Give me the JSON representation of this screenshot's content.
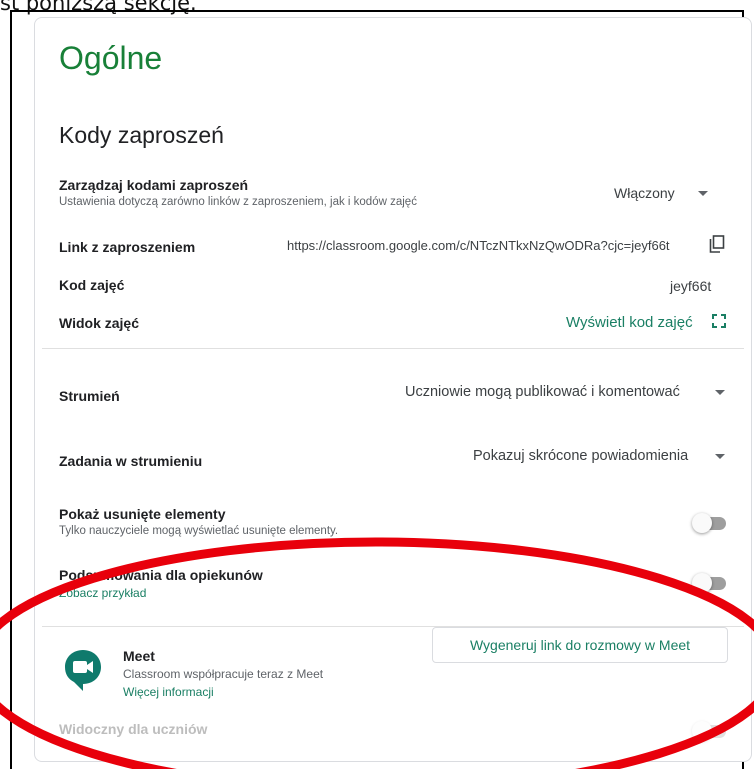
{
  "top_caption": "st poniższą sekcję.",
  "section_title": "Ogólne",
  "invite_codes_title": "Kody zaproszeń",
  "manage_codes": {
    "label": "Zarządzaj kodami zaproszeń",
    "description": "Ustawienia dotyczą zarówno linków z zaproszeniem, jak i kodów zajęć",
    "value": "Włączony"
  },
  "invite_link": {
    "label": "Link z zaproszeniem",
    "value": "https://classroom.google.com/c/NTczNTkxNzQwODRa?cjc=jeyf66t"
  },
  "class_code": {
    "label": "Kod zajęć",
    "value": "jeyf66t"
  },
  "class_view": {
    "label": "Widok zajęć",
    "action": "Wyświetl kod zajęć"
  },
  "stream": {
    "label": "Strumień",
    "value": "Uczniowie mogą publikować i komentować"
  },
  "stream_tasks": {
    "label": "Zadania w strumieniu",
    "value": "Pokazuj skrócone powiadomienia"
  },
  "show_deleted": {
    "label": "Pokaż usunięte elementy",
    "description": "Tylko nauczyciele mogą wyświetlać usunięte elementy.",
    "enabled": false
  },
  "guardian_summary": {
    "label": "Podsumowania dla opiekunów",
    "link": "Zobacz przykład",
    "enabled": false
  },
  "meet": {
    "title": "Meet",
    "description": "Classroom współpracuje teraz z Meet",
    "more_info": "Więcej informacji",
    "generate_button": "Wygeneruj link do rozmowy w Meet",
    "visible_label": "Widoczny dla uczniów",
    "visible_enabled": false
  },
  "colors": {
    "accent": "#188038",
    "link": "#1a7f64",
    "annotation": "#e8000b"
  },
  "icons": [
    "copy-icon",
    "fullscreen-icon",
    "dropdown-caret-icon",
    "meet-logo-icon"
  ]
}
